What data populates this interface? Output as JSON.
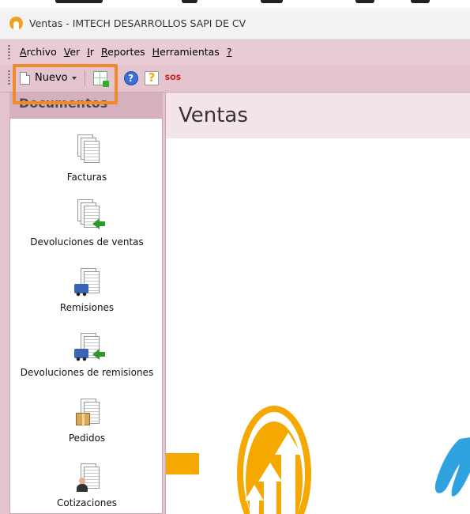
{
  "window": {
    "title": "Ventas - IMTECH DESARROLLOS SAPI DE CV"
  },
  "menu": {
    "items": [
      {
        "name": "archivo",
        "label": "Archivo",
        "mnemonic": "A",
        "rest": "rchivo"
      },
      {
        "name": "ver",
        "label": "Ver",
        "mnemonic": "V",
        "rest": "er"
      },
      {
        "name": "ir",
        "label": "Ir",
        "mnemonic": "I",
        "rest": "r"
      },
      {
        "name": "reportes",
        "label": "Reportes",
        "mnemonic": "R",
        "rest": "eportes"
      },
      {
        "name": "herramientas",
        "label": "Herramientas",
        "mnemonic": "H",
        "rest": "erramientas"
      },
      {
        "name": "ayuda",
        "label": "?",
        "mnemonic": "?",
        "rest": ""
      }
    ]
  },
  "toolbar": {
    "nuevo_label": "Nuevo",
    "help_glyph": "?",
    "sos_label": "SOS"
  },
  "documents": {
    "header": "Documentos",
    "items": [
      {
        "name": "facturas",
        "label": "Facturas",
        "icon": "documents-stack-icon"
      },
      {
        "name": "devoluciones-ventas",
        "label": "Devoluciones de ventas",
        "icon": "documents-return-icon"
      },
      {
        "name": "remisiones",
        "label": "Remisiones",
        "icon": "delivery-truck-icon"
      },
      {
        "name": "devoluciones-remisiones",
        "label": "Devoluciones de remisiones",
        "icon": "delivery-return-icon"
      },
      {
        "name": "pedidos",
        "label": "Pedidos",
        "icon": "package-box-icon"
      },
      {
        "name": "cotizaciones",
        "label": "Cotizaciones",
        "icon": "person-quote-icon"
      }
    ]
  },
  "main": {
    "title": "Ventas"
  },
  "colors": {
    "accent_pink": "#e8cbd5",
    "highlight_orange": "#f08a2c",
    "logo_gold": "#f5a800",
    "logo_blue": "#2fa2e0"
  }
}
